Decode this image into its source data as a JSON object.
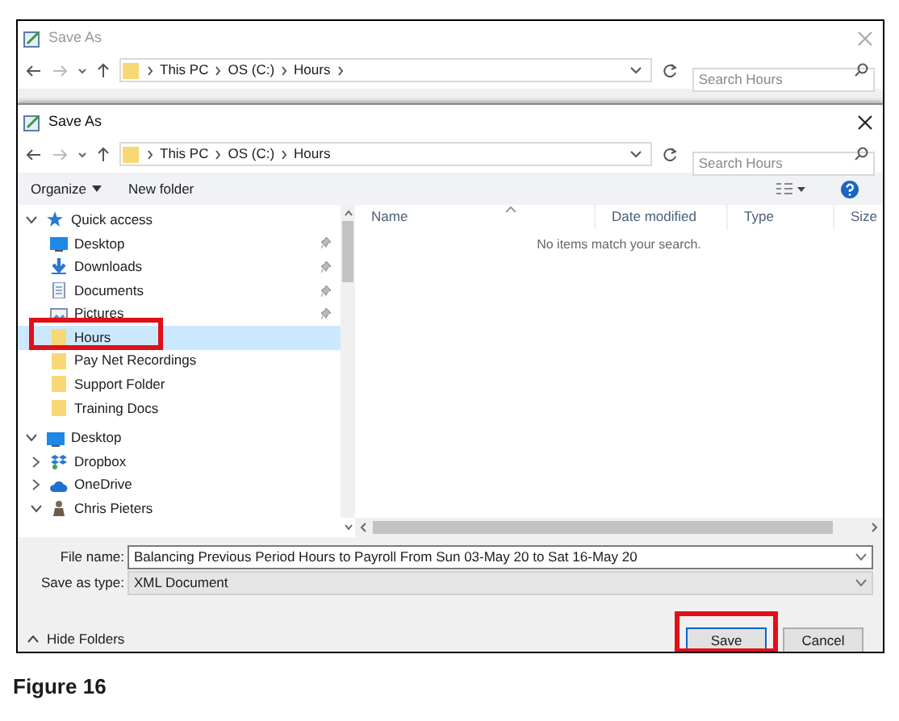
{
  "back_dialog": {
    "title": "Save As",
    "active": false,
    "path": [
      "This PC",
      "OS (C:)",
      "Hours"
    ],
    "trailing_separator": true,
    "search": {
      "placeholder": "Search Hours"
    }
  },
  "dialog": {
    "title": "Save As",
    "active": true,
    "path": [
      "This PC",
      "OS (C:)",
      "Hours"
    ],
    "trailing_separator": false,
    "search": {
      "placeholder": "Search Hours"
    }
  },
  "toolbar": {
    "organize": "Organize",
    "new_folder": "New folder"
  },
  "tree": [
    {
      "label": "Quick access",
      "kind": "star",
      "expanded": true,
      "children": [
        {
          "label": "Desktop",
          "kind": "desktop",
          "pinned": true,
          "selected": false,
          "highlighted": false
        },
        {
          "label": "Downloads",
          "kind": "download",
          "pinned": true,
          "selected": false,
          "highlighted": false
        },
        {
          "label": "Documents",
          "kind": "document",
          "pinned": true,
          "selected": false,
          "highlighted": false
        },
        {
          "label": "Pictures",
          "kind": "picture",
          "pinned": true,
          "selected": false,
          "highlighted": false
        },
        {
          "label": "Hours",
          "kind": "folder",
          "pinned": false,
          "selected": true,
          "highlighted": true
        },
        {
          "label": "Pay Net Recordings",
          "kind": "folder",
          "pinned": false,
          "selected": false,
          "highlighted": false
        },
        {
          "label": "Support Folder",
          "kind": "folder",
          "pinned": false,
          "selected": false,
          "highlighted": false
        },
        {
          "label": "Training Docs",
          "kind": "folder",
          "pinned": false,
          "selected": false,
          "highlighted": false
        }
      ]
    },
    {
      "label": "Desktop",
      "kind": "desktop",
      "expanded": true,
      "children": [
        {
          "label": "Dropbox",
          "kind": "dropbox",
          "expanded": false,
          "selected": false,
          "highlighted": false
        },
        {
          "label": "OneDrive",
          "kind": "cloud",
          "expanded": false,
          "selected": false,
          "highlighted": false
        },
        {
          "label": "Chris Pieters",
          "kind": "person",
          "expanded": true,
          "selected": false,
          "highlighted": false
        }
      ]
    }
  ],
  "table": {
    "columns": [
      "Name",
      "Date modified",
      "Type",
      "Size"
    ],
    "empty_message": "No items match your search."
  },
  "file_name": {
    "label": "File name:",
    "value": "Balancing Previous Period Hours to Payroll From Sun 03-May 20 to Sat 16-May 20"
  },
  "save_as_type": {
    "label": "Save as type:",
    "value": "XML Document"
  },
  "hide_folders": "Hide Folders",
  "buttons": [
    {
      "label": "Save",
      "kind": "primary",
      "highlighted": true
    },
    {
      "label": "Cancel",
      "kind": "secondary",
      "highlighted": false
    }
  ],
  "caption": "Figure 16"
}
